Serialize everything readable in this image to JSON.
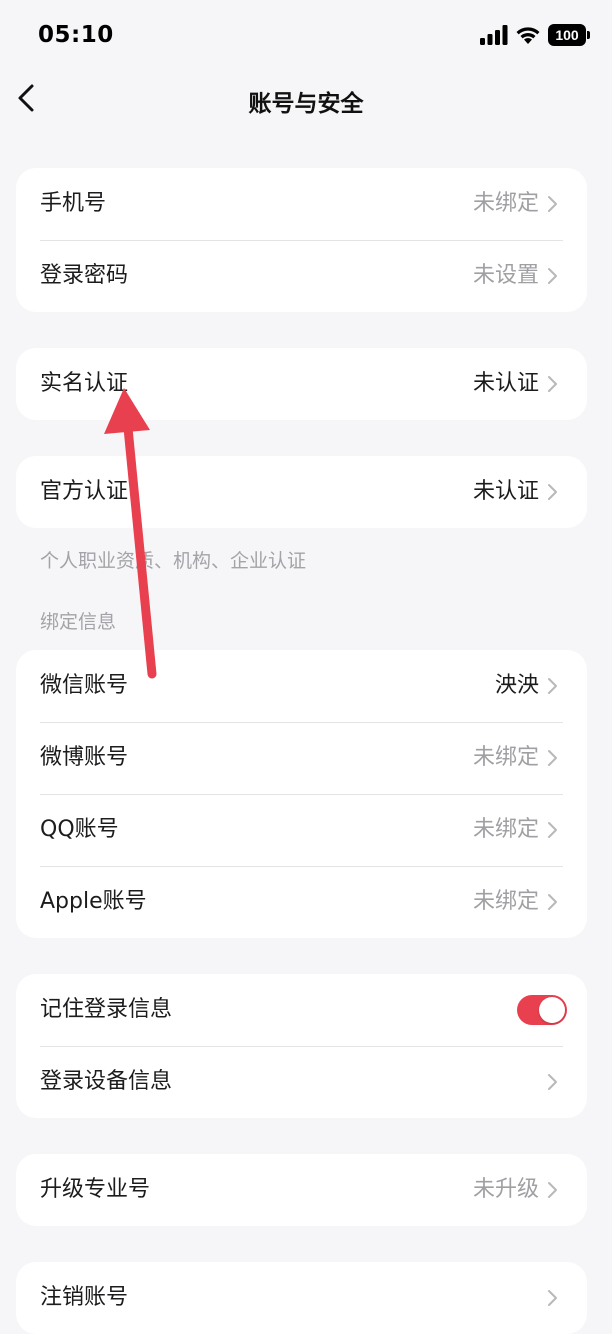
{
  "status_bar": {
    "time": "05:10",
    "battery": "100",
    "icons": [
      "signal-icon",
      "wifi-icon",
      "battery-icon"
    ]
  },
  "nav": {
    "title": "账号与安全",
    "back_icon": "chevron-left-icon"
  },
  "groups": {
    "login": [
      {
        "label": "手机号",
        "value": "未绑定"
      },
      {
        "label": "登录密码",
        "value": "未设置"
      }
    ],
    "realname": [
      {
        "label": "实名认证",
        "value": "未认证"
      }
    ],
    "official": [
      {
        "label": "官方认证",
        "value": "未认证"
      }
    ],
    "official_note": "个人职业资质、机构、企业认证",
    "binding_header": "绑定信息",
    "binding": [
      {
        "label": "微信账号",
        "value": "泱泱"
      },
      {
        "label": "微博账号",
        "value": "未绑定"
      },
      {
        "label": "QQ账号",
        "value": "未绑定"
      },
      {
        "label": "Apple账号",
        "value": "未绑定"
      }
    ],
    "device": [
      {
        "label": "记住登录信息",
        "toggle_on": true
      },
      {
        "label": "登录设备信息",
        "value": ""
      }
    ],
    "upgrade": [
      {
        "label": "升级专业号",
        "value": "未升级"
      }
    ],
    "cancel": [
      {
        "label": "注销账号",
        "value": ""
      }
    ]
  },
  "colors": {
    "accent": "#e8404f",
    "annotation_arrow": "#e8404f",
    "background": "#f6f6f8"
  }
}
